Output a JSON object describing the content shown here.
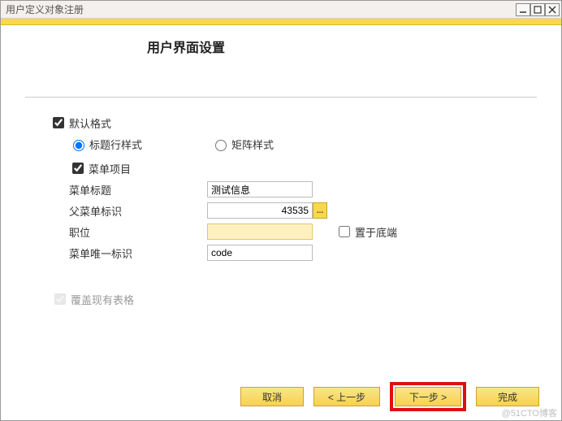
{
  "titlebar": {
    "title": "用户定义对象注册"
  },
  "header": {
    "title": "用户界面设置"
  },
  "form": {
    "default_format": "默认格式",
    "title_row_style": "标题行样式",
    "matrix_style": "矩阵样式",
    "menu_item": "菜单项目",
    "menu_title_label": "菜单标题",
    "menu_title_value": "测试信息",
    "parent_id_label": "父菜单标识",
    "parent_id_value": "43535",
    "position_label": "职位",
    "position_value": "",
    "bottom_checkbox": "置于底端",
    "unique_id_label": "菜单唯一标识",
    "unique_id_value": "code",
    "overwrite_label": "覆盖现有表格"
  },
  "buttons": {
    "cancel": "取消",
    "prev": "< 上一步",
    "next": "下一步 >",
    "finish": "完成"
  },
  "watermark": "@51CTO博客"
}
